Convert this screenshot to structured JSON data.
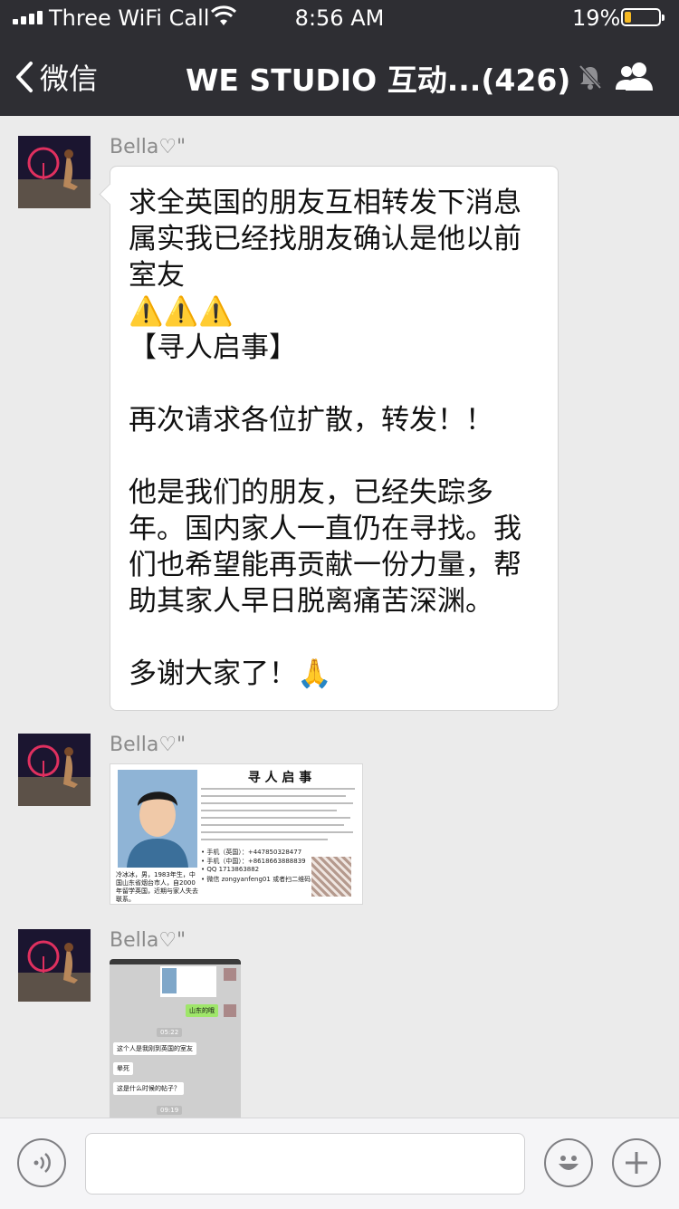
{
  "status": {
    "carrier": "Three WiFi Call",
    "time": "8:56 AM",
    "battery_percent": "19%",
    "battery_level": 0.19,
    "battery_color": "#f5b923"
  },
  "nav": {
    "back_label": "微信",
    "title": "WE STUDIO 互动...(426)",
    "icons": [
      "chevron-left-icon",
      "mute-bell-icon",
      "group-members-icon"
    ]
  },
  "messages": [
    {
      "sender": "Bella♡\"",
      "type": "text",
      "lines": [
        "求全英国的朋友互相转发下消息",
        "属实我已经找朋友确认是他以前",
        "室友",
        "⚠️⚠️⚠️",
        "【寻人启事】",
        "",
        "再次请求各位扩散，转发！！",
        "",
        "他是我们的朋友，已经失踪多",
        "年。国内家人一直仍在寻找。我",
        "们也希望能再贡献一份力量，帮",
        "助其家人早日脱离痛苦深渊。",
        "",
        "多谢大家了！🙏"
      ]
    },
    {
      "sender": "Bella♡\"",
      "type": "image",
      "poster": {
        "title": "寻 人 启 事",
        "contacts": [
          "• 手机（英国）：+447850328477",
          "• 手机（中国）：+8618663888839",
          "• QQ      1713863882",
          "• 微信    zongyanfeng01 或者扫二维码"
        ],
        "bio": "冷冰冰，男，1983年生，中国山东省烟台市人，自2000年留学英国，近期与家人失去联系。"
      }
    },
    {
      "sender": "Bella♡\"",
      "type": "image",
      "screenshot": {
        "green_msg": "山东的哦",
        "time1": "05:22",
        "msg1": "这个人是我刚到英国的室友",
        "msg2": "晕死",
        "msg3": "这是什么时候的帖子？",
        "time2": "09:19"
      }
    }
  ],
  "input_bar": {
    "icons": [
      "voice-icon",
      "emoji-icon",
      "plus-icon"
    ]
  }
}
